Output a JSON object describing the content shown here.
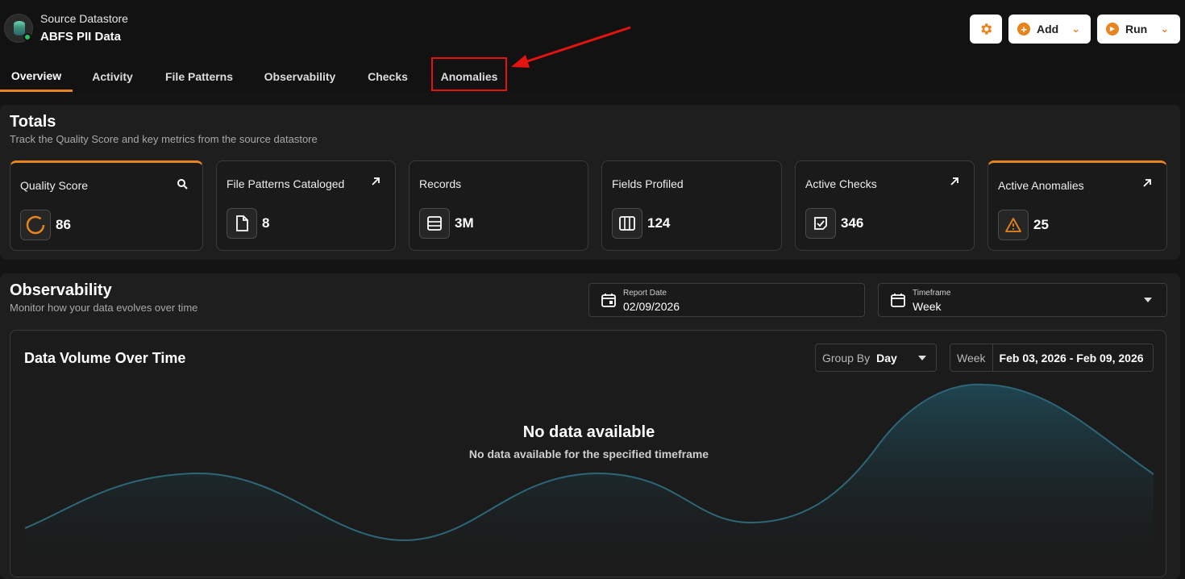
{
  "header": {
    "subtitle": "Source Datastore",
    "title": "ABFS PII Data",
    "add_label": "Add",
    "run_label": "Run"
  },
  "tabs": [
    {
      "label": "Overview",
      "active": true
    },
    {
      "label": "Activity"
    },
    {
      "label": "File Patterns"
    },
    {
      "label": "Observability"
    },
    {
      "label": "Checks"
    },
    {
      "label": "Anomalies",
      "highlighted": true
    }
  ],
  "totals": {
    "title": "Totals",
    "subtitle": "Track the Quality Score and key metrics from the source datastore",
    "cards": [
      {
        "label": "Quality Score",
        "value": "86",
        "icon": "quality-ring-icon",
        "corner_icon": "search-icon"
      },
      {
        "label": "File Patterns Cataloged",
        "value": "8",
        "icon": "file-icon",
        "corner_icon": "arrow-up-right-icon"
      },
      {
        "label": "Records",
        "value": "3M",
        "icon": "records-icon"
      },
      {
        "label": "Fields Profiled",
        "value": "124",
        "icon": "columns-icon"
      },
      {
        "label": "Active Checks",
        "value": "346",
        "icon": "check-square-icon",
        "corner_icon": "arrow-up-right-icon"
      },
      {
        "label": "Active Anomalies",
        "value": "25",
        "icon": "warning-triangle-icon",
        "corner_icon": "arrow-up-right-icon"
      }
    ]
  },
  "observability": {
    "title": "Observability",
    "subtitle": "Monitor how your data evolves over time",
    "report_date_label": "Report Date",
    "report_date_value": "02/09/2026",
    "timeframe_label": "Timeframe",
    "timeframe_value": "Week",
    "chart": {
      "title": "Data Volume Over Time",
      "group_by_label": "Group By",
      "group_by_value": "Day",
      "week_label": "Week",
      "week_range": "Feb 03, 2026 - Feb 09, 2026",
      "empty_title": "No data available",
      "empty_subtitle": "No data available for the specified timeframe"
    }
  },
  "colors": {
    "accent": "#e8841e",
    "highlight": "#e3130f",
    "status_online": "#22c55e",
    "placeholder_wave": "#2d6677"
  }
}
